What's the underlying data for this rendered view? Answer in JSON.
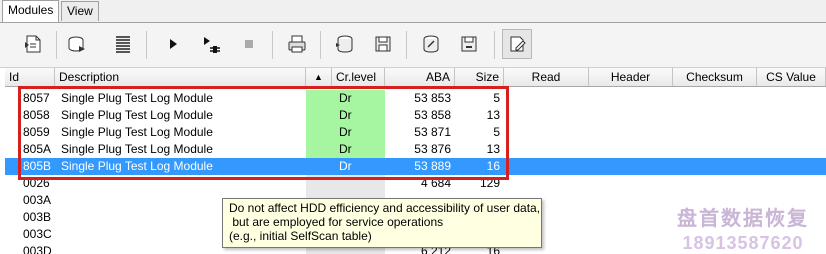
{
  "tabs": [
    {
      "label": "Modules"
    },
    {
      "label": "View"
    }
  ],
  "toolbar_icons": [
    "module-read-icon",
    "module-write-icon",
    "module-list-icon",
    "play-icon",
    "step-icon",
    "stop-icon",
    "print-icon",
    "disk-read-icon",
    "disk-save-icon",
    "disk-tool-icon",
    "disk-save-alt-icon",
    "edit-page-icon"
  ],
  "grid": {
    "columns": {
      "id": "Id",
      "description": "Description",
      "sort_arrow": "▲",
      "cr_level": "Cr.level",
      "aba": "ABA",
      "size": "Size",
      "read": "Read",
      "header": "Header",
      "checksum": "Checksum",
      "cs_value": "CS Value"
    },
    "rows": [
      {
        "id": "8057",
        "description": "Single Plug Test Log Module",
        "cr_level": "Dr",
        "aba": "53 853",
        "size": "5"
      },
      {
        "id": "8058",
        "description": "Single Plug Test Log Module",
        "cr_level": "Dr",
        "aba": "53 858",
        "size": "13"
      },
      {
        "id": "8059",
        "description": "Single Plug Test Log Module",
        "cr_level": "Dr",
        "aba": "53 871",
        "size": "5"
      },
      {
        "id": "805A",
        "description": "Single Plug Test Log Module",
        "cr_level": "Dr",
        "aba": "53 876",
        "size": "13"
      },
      {
        "id": "805B",
        "description": "Single Plug Test Log Module",
        "cr_level": "Dr",
        "aba": "53 889",
        "size": "16"
      },
      {
        "id": "0026",
        "description": "",
        "cr_level": "",
        "aba": "4 684",
        "size": "129"
      },
      {
        "id": "003A",
        "description": "",
        "cr_level": "",
        "aba": "",
        "size": ""
      },
      {
        "id": "003B",
        "description": "",
        "cr_level": "",
        "aba": "",
        "size": ""
      },
      {
        "id": "003C",
        "description": "",
        "cr_level": "",
        "aba": "",
        "size": ""
      },
      {
        "id": "003D",
        "description": "",
        "cr_level": "",
        "aba": "6 212",
        "size": "16"
      }
    ]
  },
  "tooltip": {
    "line1": "Do not affect HDD efficiency and accessibility of user data,",
    "line2": " but are employed for service operations",
    "line3": "(e.g., initial SelfScan table)"
  },
  "watermark": {
    "title": "盘首数据恢复",
    "phone": "18913587620"
  },
  "colors": {
    "selection": "#3399ff",
    "cr_level_fill": "#a6f5a0",
    "highlight_box": "#d62020",
    "tooltip_bg": "#ffffe1"
  }
}
